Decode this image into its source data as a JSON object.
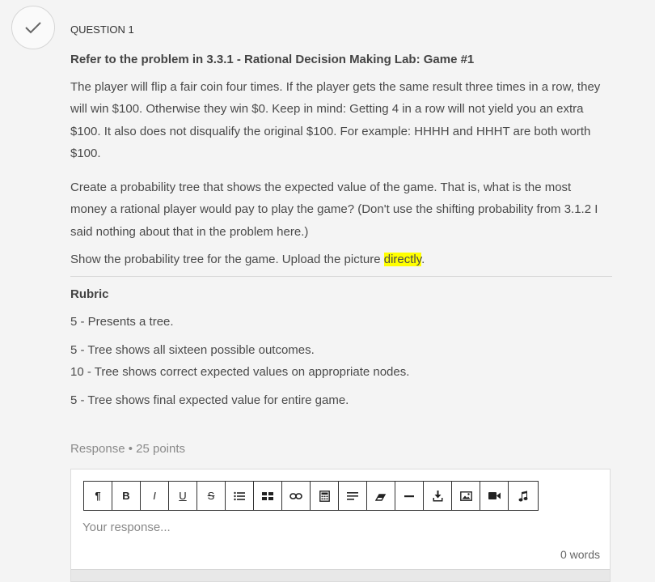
{
  "question": {
    "label": "QUESTION 1",
    "title": "Refer to the problem in 3.3.1 - Rational Decision Making Lab: Game #1",
    "para1_lines": [
      "The player will flip a fair coin four times. If the player gets the same result three times in a row, they",
      "will win $100. Otherwise they win $0. Keep in mind: Getting 4 in a row will not yield you an extra",
      "$100. It also does not disqualify the original $100. For example: HHHH and HHHT are both worth",
      "$100."
    ],
    "para2_lines": [
      "Create a probability tree that shows the expected value of the game. That is, what is the most",
      "money a rational player would pay to play the game? (Don't use the shifting probability from 3.1.2 I",
      "said nothing about that in the problem here.)"
    ],
    "para3_prefix": "Show the probability tree for the game. Upload the picture ",
    "para3_highlight": "directly",
    "para3_suffix": "."
  },
  "rubric": {
    "heading": "Rubric",
    "items": [
      "5 - Presents a tree.",
      "5 - Tree shows all sixteen possible outcomes.",
      "10 - Tree shows correct expected values on appropriate nodes.",
      "5 - Tree shows final expected value for entire game."
    ]
  },
  "response": {
    "label": "Response • 25 points",
    "placeholder": "Your response...",
    "word_count": "0 words",
    "toolbar": [
      {
        "name": "paragraph-icon",
        "glyph": "¶"
      },
      {
        "name": "bold-button",
        "glyph": "B"
      },
      {
        "name": "italic-button",
        "glyph": "I"
      },
      {
        "name": "underline-button",
        "glyph": "U"
      },
      {
        "name": "strikethrough-button",
        "glyph": "S"
      },
      {
        "name": "bullet-list-icon",
        "glyph": ""
      },
      {
        "name": "table-icon",
        "glyph": ""
      },
      {
        "name": "link-icon",
        "glyph": ""
      },
      {
        "name": "calculator-icon",
        "glyph": ""
      },
      {
        "name": "align-icon",
        "glyph": ""
      },
      {
        "name": "eraser-icon",
        "glyph": ""
      },
      {
        "name": "horizontal-rule-icon",
        "glyph": ""
      },
      {
        "name": "download-icon",
        "glyph": ""
      },
      {
        "name": "image-icon",
        "glyph": ""
      },
      {
        "name": "video-icon",
        "glyph": ""
      },
      {
        "name": "audio-icon",
        "glyph": ""
      }
    ]
  },
  "colors": {
    "highlight": "#ffff00",
    "background": "#f4f4f4"
  }
}
